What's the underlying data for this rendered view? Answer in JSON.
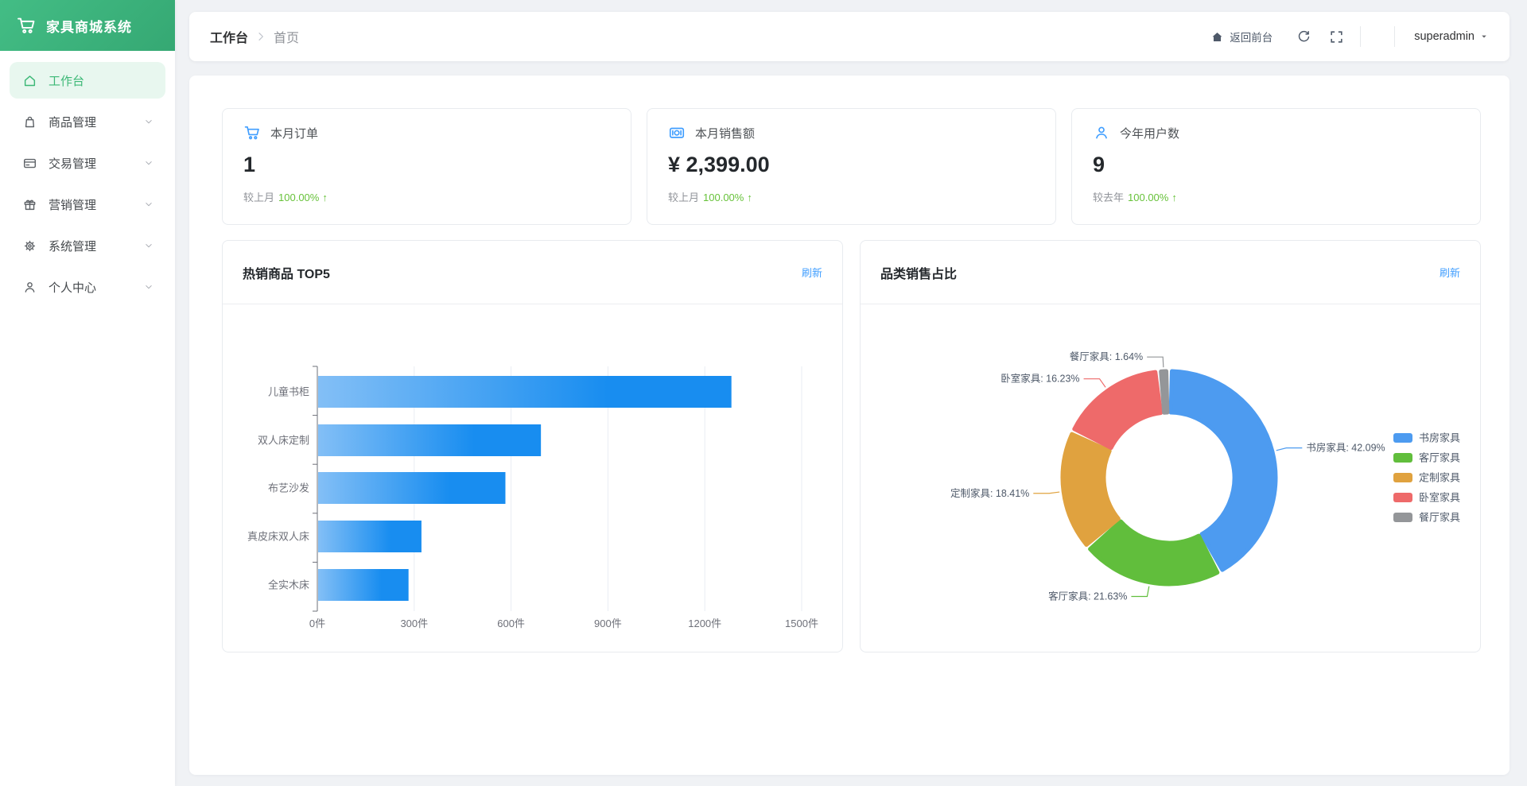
{
  "brand": {
    "title": "家具商城系统",
    "icon": "cart-icon"
  },
  "sidebar": {
    "items": [
      {
        "name": "workbench",
        "label": "工作台",
        "icon": "home-icon",
        "active": true,
        "expandable": false
      },
      {
        "name": "product-management",
        "label": "商品管理",
        "icon": "bag-icon",
        "active": false,
        "expandable": true
      },
      {
        "name": "trade-management",
        "label": "交易管理",
        "icon": "card-icon",
        "active": false,
        "expandable": true
      },
      {
        "name": "marketing-management",
        "label": "营销管理",
        "icon": "gift-icon",
        "active": false,
        "expandable": true
      },
      {
        "name": "system-management",
        "label": "系统管理",
        "icon": "gear-icon",
        "active": false,
        "expandable": true
      },
      {
        "name": "profile-center",
        "label": "个人中心",
        "icon": "user-icon",
        "active": false,
        "expandable": true
      }
    ]
  },
  "header": {
    "breadcrumb": [
      "工作台",
      "首页"
    ],
    "back_home_label": "返回前台",
    "username": "superadmin"
  },
  "stats": [
    {
      "name": "monthly-orders",
      "icon": "cart-icon",
      "label": "本月订单",
      "value": "1",
      "compare_label": "较上月",
      "compare_value": "100.00%",
      "trend": "up",
      "trend_icon": "arrow-up-icon"
    },
    {
      "name": "monthly-sales",
      "icon": "money-icon",
      "label": "本月销售额",
      "value": "¥ 2,399.00",
      "compare_label": "较上月",
      "compare_value": "100.00%",
      "trend": "up",
      "trend_icon": "arrow-up-icon"
    },
    {
      "name": "yearly-users",
      "icon": "user-icon",
      "label": "今年用户数",
      "value": "9",
      "compare_label": "较去年",
      "compare_value": "100.00%",
      "trend": "up",
      "trend_icon": "arrow-up-icon"
    }
  ],
  "panels": {
    "hot_products": {
      "title": "热销商品 TOP5",
      "refresh_label": "刷新"
    },
    "category_share": {
      "title": "品类销售占比",
      "refresh_label": "刷新"
    }
  },
  "chart_data": [
    {
      "type": "bar",
      "orientation": "horizontal",
      "title": "热销商品 TOP5",
      "categories": [
        "儿童书柜",
        "双人床定制",
        "布艺沙发",
        "真皮床双人床",
        "全实木床"
      ],
      "values": [
        1280,
        690,
        580,
        320,
        280
      ],
      "unit": "件",
      "xlabel": "",
      "ylabel": "",
      "xlim": [
        0,
        1500
      ],
      "xticks": [
        0,
        300,
        600,
        900,
        1200,
        1500
      ],
      "grid": true,
      "bar_gradient": [
        "#83bff6",
        "#188df0"
      ]
    },
    {
      "type": "pie",
      "donut": true,
      "title": "品类销售占比",
      "series": [
        {
          "name": "书房家具",
          "value": 42.09,
          "color": "#4d9bf0"
        },
        {
          "name": "客厅家具",
          "value": 21.63,
          "color": "#61be3c"
        },
        {
          "name": "定制家具",
          "value": 18.41,
          "color": "#e0a23f"
        },
        {
          "name": "卧室家具",
          "value": 16.23,
          "color": "#ee6a6a"
        },
        {
          "name": "餐厅家具",
          "value": 1.64,
          "color": "#949699"
        }
      ],
      "label_format": "{name}: {value}%",
      "legend_position": "right",
      "legend": [
        "书房家具",
        "客厅家具",
        "定制家具",
        "卧室家具",
        "餐厅家具"
      ]
    }
  ],
  "colors": {
    "primary": "#409eff",
    "success": "#67c23a",
    "brand_green": "#3cb876"
  }
}
